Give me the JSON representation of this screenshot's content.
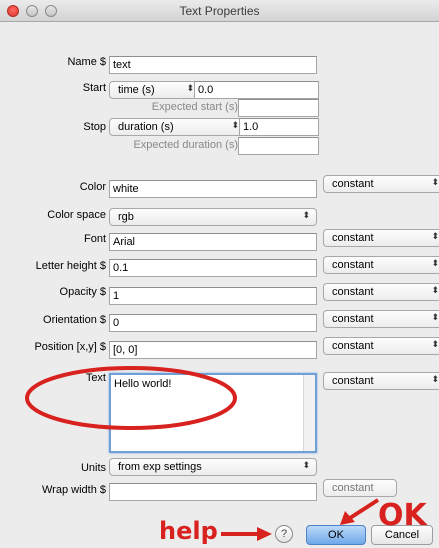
{
  "window": {
    "title": "Text Properties"
  },
  "fields": {
    "name": {
      "label": "Name $",
      "value": "text"
    },
    "start": {
      "label": "Start",
      "type": "time (s)",
      "value": "0.0",
      "expected_label": "Expected start (s)",
      "expected_value": ""
    },
    "stop": {
      "label": "Stop",
      "type": "duration (s)",
      "value": "1.0",
      "expected_label": "Expected duration (s)",
      "expected_value": ""
    },
    "color": {
      "label": "Color",
      "value": "white",
      "update": "constant"
    },
    "color_space": {
      "label": "Color space",
      "value": "rgb"
    },
    "font": {
      "label": "Font",
      "value": "Arial",
      "update": "constant"
    },
    "letter_height": {
      "label": "Letter height $",
      "value": "0.1",
      "update": "constant"
    },
    "opacity": {
      "label": "Opacity $",
      "value": "1",
      "update": "constant"
    },
    "orientation": {
      "label": "Orientation $",
      "value": "0",
      "update": "constant"
    },
    "position": {
      "label": "Position [x,y] $",
      "value": "[0, 0]",
      "update": "constant"
    },
    "text": {
      "label": "Text",
      "value": "Hello world!",
      "update": "constant"
    },
    "units": {
      "label": "Units",
      "value": "from exp settings"
    },
    "wrap_width": {
      "label": "Wrap width $",
      "value": "",
      "update": "constant"
    }
  },
  "buttons": {
    "help": "?",
    "ok": "OK",
    "cancel": "Cancel"
  },
  "annotations": {
    "help": "help",
    "ok": "OK",
    "color": "#d8221f"
  },
  "icons": {
    "combo_arrow": "up-down-arrows-icon",
    "close": "close-icon",
    "minimize": "minimize-icon",
    "zoom": "zoom-icon"
  }
}
